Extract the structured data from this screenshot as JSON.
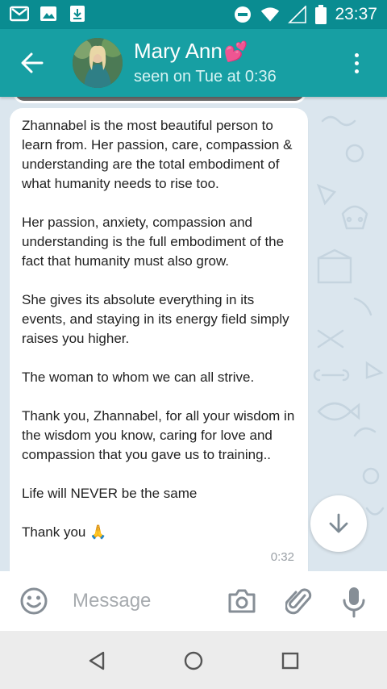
{
  "status_bar": {
    "time": "23:37",
    "icons": [
      "gmail-icon",
      "gallery-icon",
      "download-icon",
      "do-not-disturb-icon",
      "wifi-icon",
      "cell-signal-icon",
      "battery-icon"
    ]
  },
  "header": {
    "contact_name": "Mary Ann",
    "name_emoji": "💕",
    "status": "seen on Tue at 0:36"
  },
  "message": {
    "paragraphs": [
      "Zhannabel is the most beautiful person to learn from. Her passion, care, compassion & understanding are the total embodiment of what humanity needs to rise too.",
      "Her passion, anxiety, compassion and understanding is the full embodiment of the fact that humanity must also grow.",
      "She gives its absolute everything in its events, and staying in its energy field simply raises you higher.",
      "The woman to whom we can all strive.",
      "Thank you, Zhannabel, for all your wisdom in the wisdom you know, caring for love and compassion that you gave us to training..",
      "Life will NEVER be the same",
      "Thank you 🙏"
    ],
    "time": "0:32"
  },
  "input": {
    "placeholder": "Message"
  },
  "colors": {
    "header": "#179fa3",
    "status_bar": "#0a8c91",
    "chat_background": "#dbe6ee",
    "bubble": "#ffffff"
  }
}
